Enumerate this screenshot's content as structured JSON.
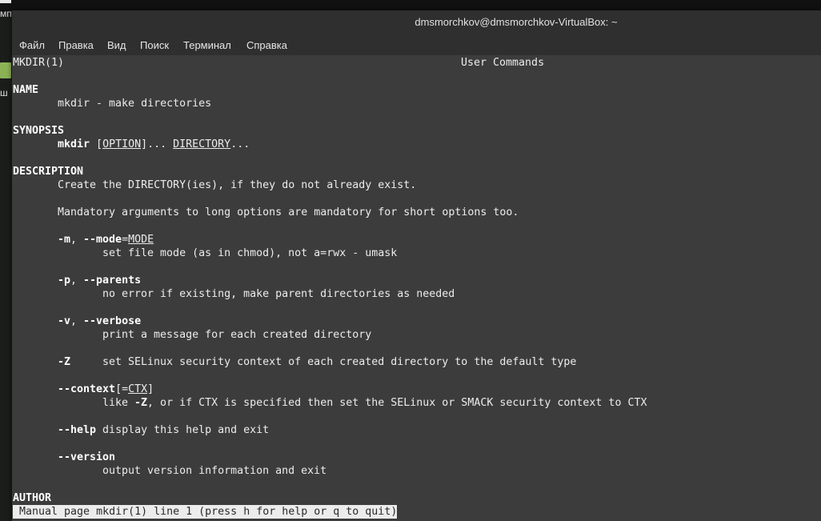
{
  "desktop": {
    "fragment_top": "мп",
    "fragment_mid": "ш"
  },
  "window": {
    "title": "dmsmorchkov@dmsmorchkov-VirtualBox: ~"
  },
  "menu": {
    "file": "Файл",
    "edit": "Правка",
    "view": "Вид",
    "search": "Поиск",
    "terminal": "Терминал",
    "help": "Справка"
  },
  "man": {
    "header_left": "MKDIR(1)",
    "header_center": "User Commands",
    "name_heading": "NAME",
    "name_text": "mkdir - make directories",
    "synopsis_heading": "SYNOPSIS",
    "synopsis_cmd": "mkdir",
    "synopsis_open": "[",
    "synopsis_option": "OPTION",
    "synopsis_close": "]... ",
    "synopsis_dir": "DIRECTORY",
    "synopsis_dots": "...",
    "description_heading": "DESCRIPTION",
    "desc_line1": "Create the DIRECTORY(ies), if they do not already exist.",
    "desc_line2": "Mandatory arguments to long options are mandatory for short options too.",
    "opt_m_short": "-m",
    "opt_m_sep": ", ",
    "opt_m_long": "--mode",
    "opt_m_eq": "=",
    "opt_m_arg": "MODE",
    "opt_m_desc": "set file mode (as in chmod), not a=rwx - umask",
    "opt_p_short": "-p",
    "opt_p_sep": ", ",
    "opt_p_long": "--parents",
    "opt_p_desc": "no error if existing, make parent directories as needed",
    "opt_v_short": "-v",
    "opt_v_sep": ", ",
    "opt_v_long": "--verbose",
    "opt_v_desc": "print a message for each created directory",
    "opt_z_short": "-Z",
    "opt_z_desc": "set SELinux security context of each created directory to the default type",
    "opt_ctx_long": "--context",
    "opt_ctx_open": "[=",
    "opt_ctx_arg": "CTX",
    "opt_ctx_close": "]",
    "opt_ctx_desc_a": "like ",
    "opt_ctx_desc_z": "-Z",
    "opt_ctx_desc_b": ", or if CTX is specified then set the SELinux or SMACK security context to CTX",
    "opt_help_long": "--help",
    "opt_help_desc": " display this help and exit",
    "opt_version_long": "--version",
    "opt_version_desc": "output version information and exit",
    "author_heading": "AUTHOR"
  },
  "status": {
    "text": " Manual page mkdir(1) line 1 (press h for help or q to quit)"
  }
}
